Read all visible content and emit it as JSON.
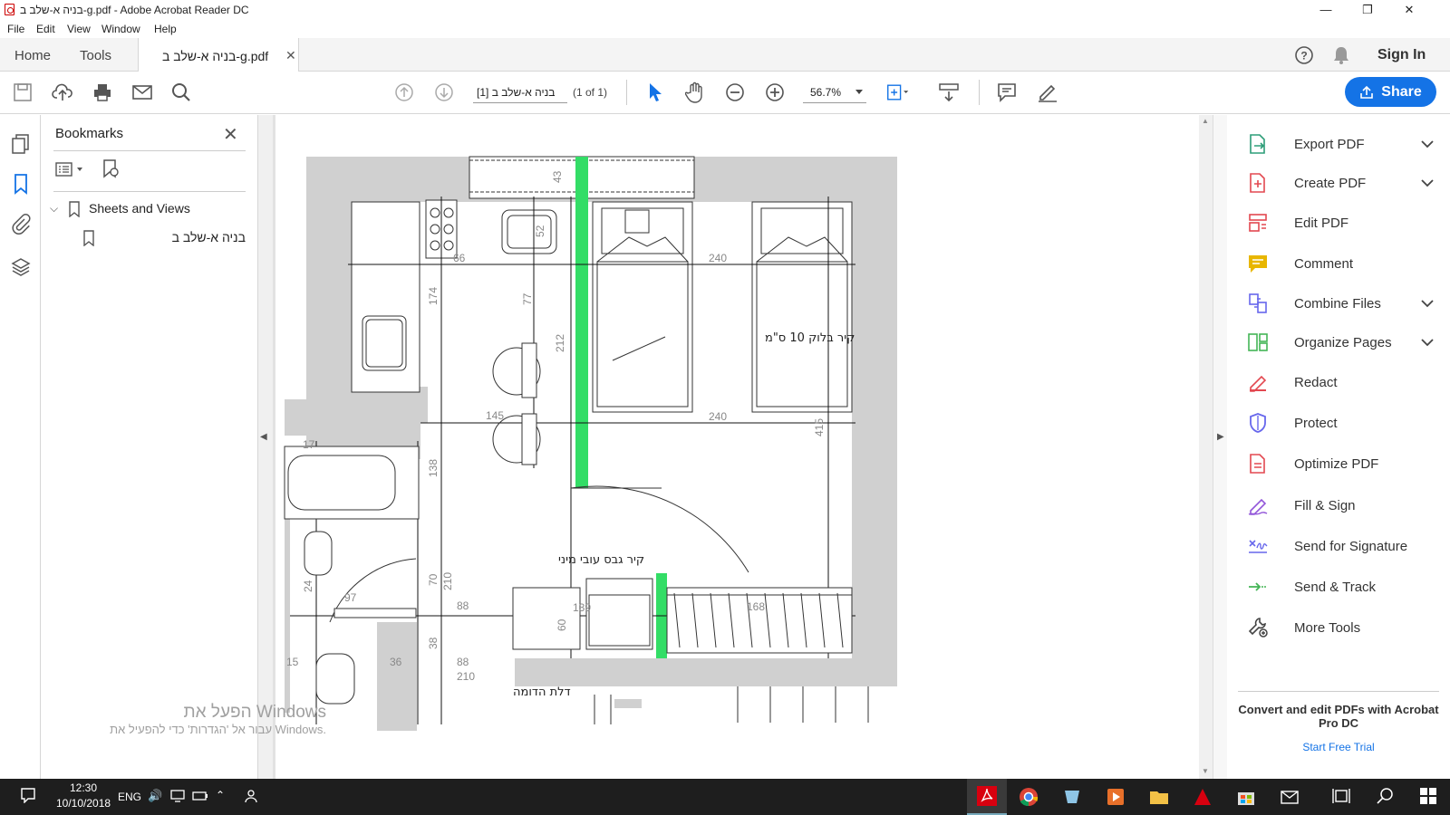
{
  "window": {
    "title": "בניה א-שלב ב-g.pdf - Adobe Acrobat Reader DC"
  },
  "menu": [
    "File",
    "Edit",
    "View",
    "Window",
    "Help"
  ],
  "tabs": {
    "home": "Home",
    "tools": "Tools",
    "document": "בניה א-שלב ב-g.pdf"
  },
  "header": {
    "sign_in": "Sign In"
  },
  "toolbar": {
    "page_field": "[1] בניה א-שלב ב",
    "page_count": "(1 of 1)",
    "zoom": "56.7%",
    "share": "Share"
  },
  "bookmarks": {
    "title": "Bookmarks",
    "items": [
      {
        "label": "Sheets and Views",
        "expanded": true
      },
      {
        "label": "בניה א-שלב ב"
      }
    ]
  },
  "drawing": {
    "dims": [
      "43",
      "240",
      "240",
      "52",
      "174",
      "77",
      "145",
      "212",
      "138",
      "415",
      "97",
      "24",
      "88",
      "88",
      "70",
      "210",
      "38",
      "36",
      "210",
      "168",
      "139",
      "60",
      "17",
      "15",
      "66"
    ],
    "labels": [
      "קיר בלוק 10 ס\"מ",
      "קיר גבס עובי מיני",
      "דלת הדומה"
    ]
  },
  "tools": [
    {
      "label": "Export PDF",
      "expandable": true,
      "icon": "export-pdf-icon",
      "color": "#2d9d78"
    },
    {
      "label": "Create PDF",
      "expandable": true,
      "icon": "create-pdf-icon",
      "color": "#e34850"
    },
    {
      "label": "Edit PDF",
      "expandable": false,
      "icon": "edit-pdf-icon",
      "color": "#e34850"
    },
    {
      "label": "Comment",
      "expandable": false,
      "icon": "comment-icon",
      "color": "#e8b600"
    },
    {
      "label": "Combine Files",
      "expandable": true,
      "icon": "combine-files-icon",
      "color": "#6767ec"
    },
    {
      "label": "Organize Pages",
      "expandable": true,
      "icon": "organize-pages-icon",
      "color": "#44b556"
    },
    {
      "label": "Redact",
      "expandable": false,
      "icon": "redact-icon",
      "color": "#e34850"
    },
    {
      "label": "Protect",
      "expandable": false,
      "icon": "protect-icon",
      "color": "#6767ec"
    },
    {
      "label": "Optimize PDF",
      "expandable": false,
      "icon": "optimize-pdf-icon",
      "color": "#e34850"
    },
    {
      "label": "Fill & Sign",
      "expandable": false,
      "icon": "fill-sign-icon",
      "color": "#9256d9"
    },
    {
      "label": "Send for Signature",
      "expandable": false,
      "icon": "send-signature-icon",
      "color": "#6767ec"
    },
    {
      "label": "Send & Track",
      "expandable": false,
      "icon": "send-track-icon",
      "color": "#44b556"
    },
    {
      "label": "More Tools",
      "expandable": false,
      "icon": "more-tools-icon",
      "color": "#444444"
    }
  ],
  "promo": {
    "text": "Convert and edit PDFs with Acrobat Pro DC",
    "link": "Start Free Trial"
  },
  "watermark": {
    "line1": "הפעל את Windows",
    "line2": "עבור אל 'הגדרות' כדי להפעיל את Windows."
  },
  "taskbar": {
    "time": "12:30",
    "date": "10/10/2018",
    "lang": "ENG"
  },
  "colors": {
    "accent": "#1473e6",
    "wall": "#d0d0d0",
    "partition": "#33dd66"
  }
}
